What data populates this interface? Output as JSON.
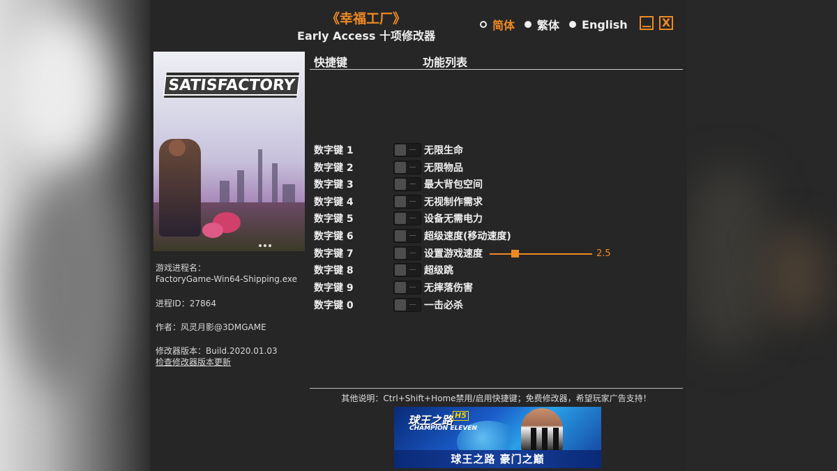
{
  "app": {
    "title_game": "《幸福工厂》",
    "title_trainer": "Early Access 十项修改器"
  },
  "languages": [
    {
      "label": "简体",
      "active": true
    },
    {
      "label": "繁体",
      "active": false
    },
    {
      "label": "English",
      "active": false
    }
  ],
  "window_controls": {
    "minimize_icon": "minimize-icon",
    "close_symbol": "X"
  },
  "cover": {
    "logo_text": "SATISFACTORY"
  },
  "info": {
    "process_label": "游戏进程名：",
    "process_value": "FactoryGame-Win64-Shipping.exe",
    "pid": "进程ID：27864",
    "author": "作者：风灵月影@3DMGAME",
    "version": "修改器版本：Build.2020.01.03",
    "update_link": "检查修改器版本更新"
  },
  "table": {
    "col_hotkey": "快捷键",
    "col_features": "功能列表",
    "rows": [
      {
        "key": "数字键 1",
        "label": "无限生命",
        "enabled": false
      },
      {
        "key": "数字键 2",
        "label": "无限物品",
        "enabled": false
      },
      {
        "key": "数字键 3",
        "label": "最大背包空间",
        "enabled": false
      },
      {
        "key": "数字键 4",
        "label": "无视制作需求",
        "enabled": false
      },
      {
        "key": "数字键 5",
        "label": "设备无需电力",
        "enabled": false
      },
      {
        "key": "数字键 6",
        "label": "超级速度(移动速度)",
        "enabled": false
      },
      {
        "key": "数字键 7",
        "label": "设置游戏速度",
        "enabled": false
      },
      {
        "key": "数字键 8",
        "label": "超级跳",
        "enabled": false
      },
      {
        "key": "数字键 9",
        "label": "无摔落伤害",
        "enabled": false
      },
      {
        "key": "数字键 0",
        "label": "一击必杀",
        "enabled": false
      }
    ]
  },
  "game_speed": {
    "value": "2.5",
    "fraction": 0.25
  },
  "footer": {
    "note": "其他说明：Ctrl+Shift+Home禁用/启用快捷键；免费修改器，希望玩家广告支持！"
  },
  "ad": {
    "title": "球王之路",
    "badge": "H5",
    "subtitle": "CHAMPION ELEVEN",
    "slogan": "球王之路 豪门之巅"
  },
  "colors": {
    "accent": "#f08a24",
    "background": "#262626",
    "text": "#e6e6e6"
  }
}
